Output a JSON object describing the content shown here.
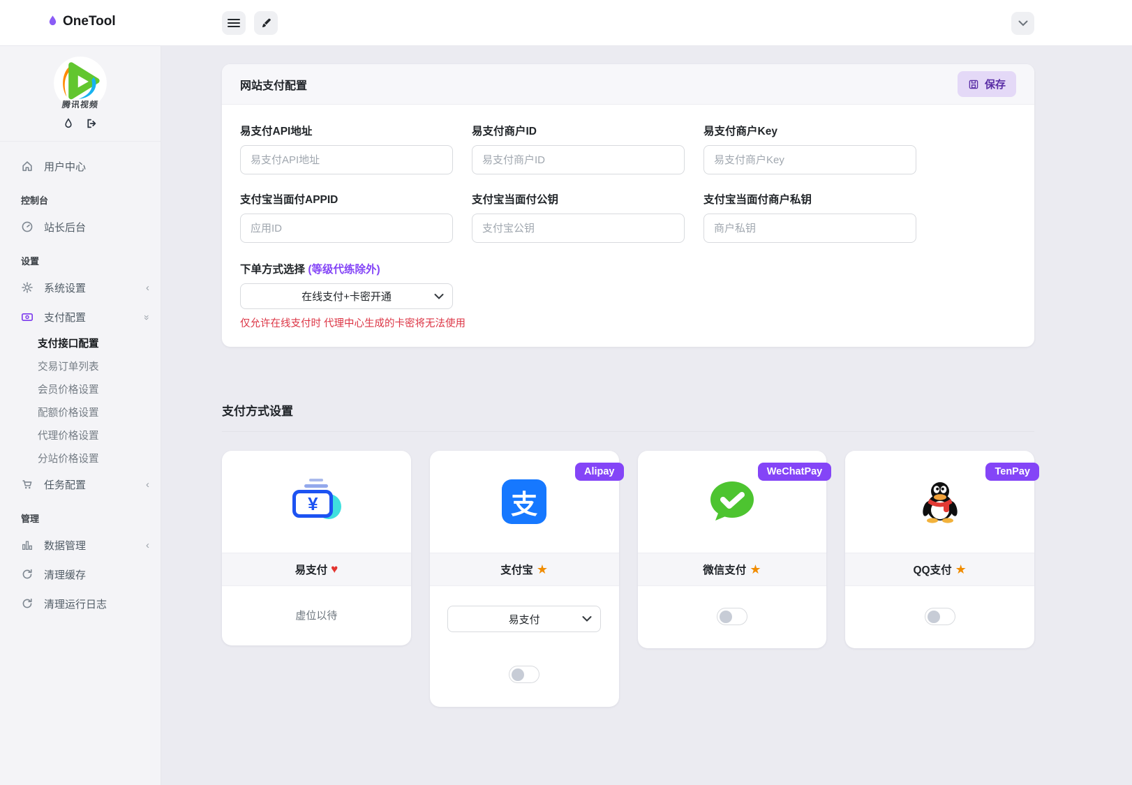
{
  "topbar": {
    "brand": "OneTool"
  },
  "sidebar": {
    "avatar_caption": "腾讯视频",
    "items": [
      {
        "label": "用户中心"
      },
      {
        "label": "控制台"
      },
      {
        "label": "站长后台"
      },
      {
        "label": "设置"
      },
      {
        "label": "系统设置"
      },
      {
        "label": "支付配置"
      },
      {
        "label": "支付接口配置"
      },
      {
        "label": "交易订单列表"
      },
      {
        "label": "会员价格设置"
      },
      {
        "label": "配额价格设置"
      },
      {
        "label": "代理价格设置"
      },
      {
        "label": "分站价格设置"
      },
      {
        "label": "任务配置"
      },
      {
        "label": "管理"
      },
      {
        "label": "数据管理"
      },
      {
        "label": "清理缓存"
      },
      {
        "label": "清理运行日志"
      }
    ]
  },
  "form": {
    "title": "网站支付配置",
    "save_label": "保存",
    "fields": [
      {
        "label": "易支付API地址",
        "placeholder": "易支付API地址"
      },
      {
        "label": "易支付商户ID",
        "placeholder": "易支付商户ID"
      },
      {
        "label": "易支付商户Key",
        "placeholder": "易支付商户Key"
      },
      {
        "label": "支付宝当面付APPID",
        "placeholder": "应用ID"
      },
      {
        "label": "支付宝当面付公钥",
        "placeholder": "支付宝公钥"
      },
      {
        "label": "支付宝当面付商户私钥",
        "placeholder": "商户私钥"
      }
    ],
    "order_mode": {
      "label": "下单方式选择",
      "note": "(等级代练除外)",
      "selected": "在线支付+卡密开通",
      "warning": "仅允许在线支付时 代理中心生成的卡密将无法使用"
    }
  },
  "methods": {
    "title": "支付方式设置",
    "cards": [
      {
        "name": "易支付",
        "suffix": "♥",
        "body_text": "虚位以待"
      },
      {
        "name": "支付宝",
        "suffix": "★",
        "badge": "Alipay",
        "select_value": "易支付",
        "toggle_on": false
      },
      {
        "name": "微信支付",
        "suffix": "★",
        "badge": "WeChatPay",
        "toggle_on": false
      },
      {
        "name": "QQ支付",
        "suffix": "★",
        "badge": "TenPay",
        "toggle_on": false
      }
    ]
  },
  "colors": {
    "accent_purple": "#8445f7",
    "save_button_bg": "#e4d9f7",
    "warning_red": "#dc3545",
    "star_orange": "#f08c00",
    "heart_red": "#e3342f",
    "alipay_blue": "#1678ff",
    "wechat_green": "#4dc430"
  }
}
